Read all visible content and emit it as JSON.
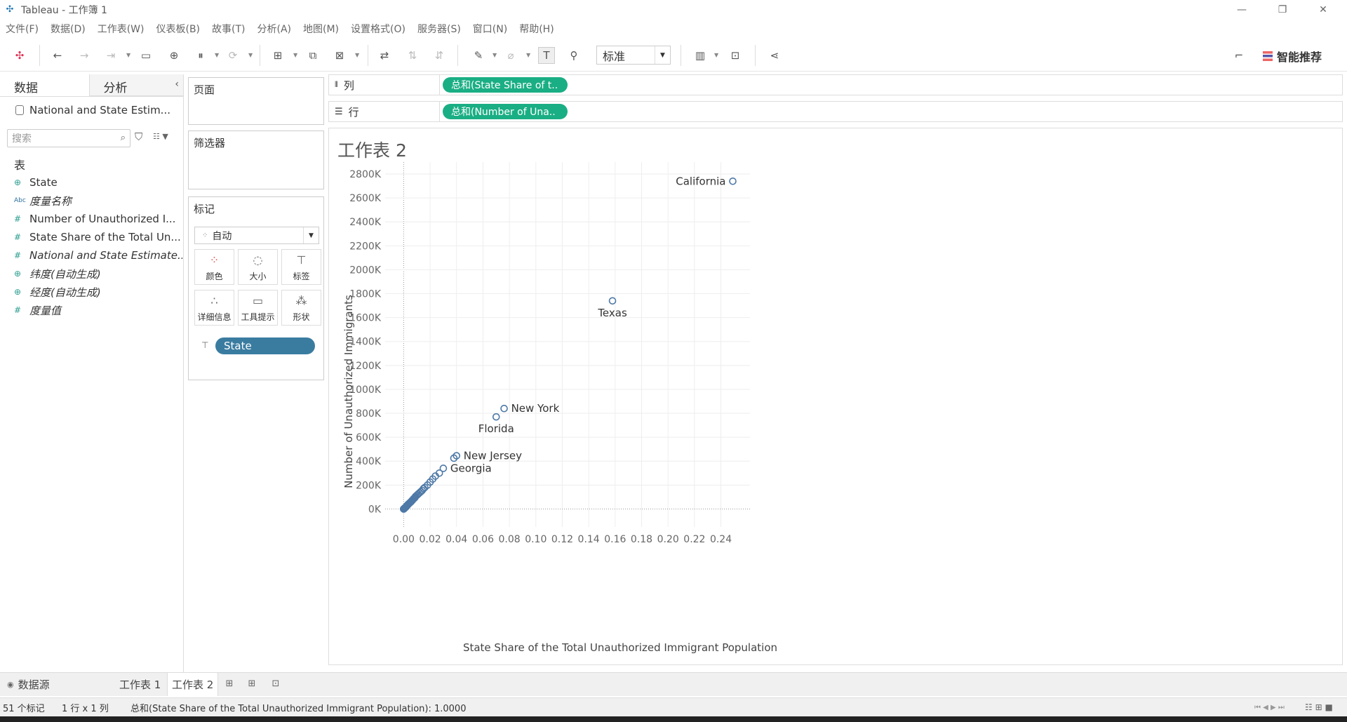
{
  "window": {
    "title": "Tableau - 工作簿 1"
  },
  "menu": [
    "文件(F)",
    "数据(D)",
    "工作表(W)",
    "仪表板(B)",
    "故事(T)",
    "分析(A)",
    "地图(M)",
    "设置格式(O)",
    "服务器(S)",
    "窗口(N)",
    "帮助(H)"
  ],
  "toolbar": {
    "fit_value": "标准",
    "smart_label": "智能推荐"
  },
  "left_panel": {
    "tab_data": "数据",
    "tab_analysis": "分析",
    "data_source": "National and State Estim...",
    "search_placeholder": "搜索",
    "table_label": "表",
    "fields": [
      {
        "icon": "globe-icon",
        "label": "State",
        "italic": false
      },
      {
        "icon": "abc-icon",
        "label": "度量名称",
        "italic": true
      },
      {
        "icon": "number-icon",
        "label": "Number of Unauthorized I...",
        "italic": false
      },
      {
        "icon": "number-icon",
        "label": "State Share of the Total Un...",
        "italic": false
      },
      {
        "icon": "number-icon",
        "label": "National and State Estimate...",
        "italic": true
      },
      {
        "icon": "globe-icon",
        "label": "纬度(自动生成)",
        "italic": true
      },
      {
        "icon": "globe-icon",
        "label": "经度(自动生成)",
        "italic": true
      },
      {
        "icon": "number-icon",
        "label": "度量值",
        "italic": true
      }
    ]
  },
  "cards": {
    "pages": "页面",
    "filters": "筛选器",
    "marks": "标记",
    "mark_type": "自动",
    "buttons": [
      "颜色",
      "大小",
      "标签",
      "详细信息",
      "工具提示",
      "形状"
    ],
    "pill": "State"
  },
  "shelves": {
    "columns_label": "列",
    "columns_pill": "总和(State Share of t..",
    "rows_label": "行",
    "rows_pill": "总和(Number of Una.."
  },
  "sheet_title": "工作表 2",
  "chart_data": {
    "type": "scatter",
    "xlabel": "State Share of the Total Unauthorized Immigrant Population",
    "ylabel": "Number of Unauthorized Immigrants",
    "xlim": [
      -0.014,
      0.262
    ],
    "ylim": [
      -150000,
      2900000
    ],
    "x_ticks": [
      "0.00",
      "0.02",
      "0.04",
      "0.06",
      "0.08",
      "0.10",
      "0.12",
      "0.14",
      "0.16",
      "0.18",
      "0.20",
      "0.22",
      "0.24"
    ],
    "x_tick_values": [
      0,
      0.02,
      0.04,
      0.06,
      0.08,
      0.1,
      0.12,
      0.14,
      0.16,
      0.18,
      0.2,
      0.22,
      0.24
    ],
    "y_ticks": [
      "0K",
      "200K",
      "400K",
      "600K",
      "800K",
      "1000K",
      "1200K",
      "1400K",
      "1600K",
      "1800K",
      "2000K",
      "2200K",
      "2400K",
      "2600K",
      "2800K"
    ],
    "y_tick_values": [
      0,
      200000,
      400000,
      600000,
      800000,
      1000000,
      1200000,
      1400000,
      1600000,
      1800000,
      2000000,
      2200000,
      2400000,
      2600000,
      2800000
    ],
    "labeled_points": [
      {
        "label": "California",
        "x": 0.249,
        "y": 2740000,
        "label_pos": "left"
      },
      {
        "label": "Texas",
        "x": 0.158,
        "y": 1740000,
        "label_pos": "below"
      },
      {
        "label": "New York",
        "x": 0.076,
        "y": 840000,
        "label_pos": "right"
      },
      {
        "label": "Florida",
        "x": 0.07,
        "y": 770000,
        "label_pos": "below"
      },
      {
        "label": "New Jersey",
        "x": 0.04,
        "y": 445000,
        "label_pos": "right"
      },
      {
        "label": "Georgia",
        "x": 0.03,
        "y": 340000,
        "label_pos": "right"
      }
    ],
    "points": [
      [
        0.038,
        425000
      ],
      [
        0.027,
        300000
      ],
      [
        0.024,
        275000
      ],
      [
        0.022,
        250000
      ],
      [
        0.02,
        225000
      ],
      [
        0.018,
        200000
      ],
      [
        0.016,
        180000
      ],
      [
        0.015,
        170000
      ],
      [
        0.014,
        155000
      ],
      [
        0.013,
        145000
      ],
      [
        0.012,
        135000
      ],
      [
        0.011,
        125000
      ],
      [
        0.01,
        115000
      ],
      [
        0.009,
        105000
      ],
      [
        0.0085,
        95000
      ],
      [
        0.008,
        90000
      ],
      [
        0.0075,
        85000
      ],
      [
        0.007,
        78000
      ],
      [
        0.0065,
        72000
      ],
      [
        0.006,
        66000
      ],
      [
        0.0055,
        60000
      ],
      [
        0.005,
        55000
      ],
      [
        0.0045,
        50000
      ],
      [
        0.004,
        45000
      ],
      [
        0.0035,
        40000
      ],
      [
        0.003,
        35000
      ],
      [
        0.0028,
        30000
      ],
      [
        0.0025,
        27000
      ],
      [
        0.0022,
        24000
      ],
      [
        0.002,
        21000
      ],
      [
        0.0018,
        18000
      ],
      [
        0.0015,
        15000
      ],
      [
        0.0012,
        12000
      ],
      [
        0.001,
        10000
      ],
      [
        0.0008,
        8000
      ],
      [
        0.0006,
        6000
      ],
      [
        0.0005,
        5000
      ],
      [
        0.0004,
        4000
      ],
      [
        0.0003,
        3000
      ],
      [
        0.0002,
        2000
      ],
      [
        0.0001,
        1000
      ],
      [
        0.0001,
        500
      ],
      [
        0.0,
        200
      ],
      [
        0.0,
        100
      ]
    ],
    "grid": true,
    "mark_color": "#4e79a7"
  },
  "bottom_tabs": {
    "data_source": "数据源",
    "sheet1": "工作表 1",
    "sheet2": "工作表 2"
  },
  "status": {
    "marks": "51 个标记",
    "dims": "1 行 x 1 列",
    "sum": "总和(State Share of the Total Unauthorized Immigrant Population): 1.0000"
  }
}
